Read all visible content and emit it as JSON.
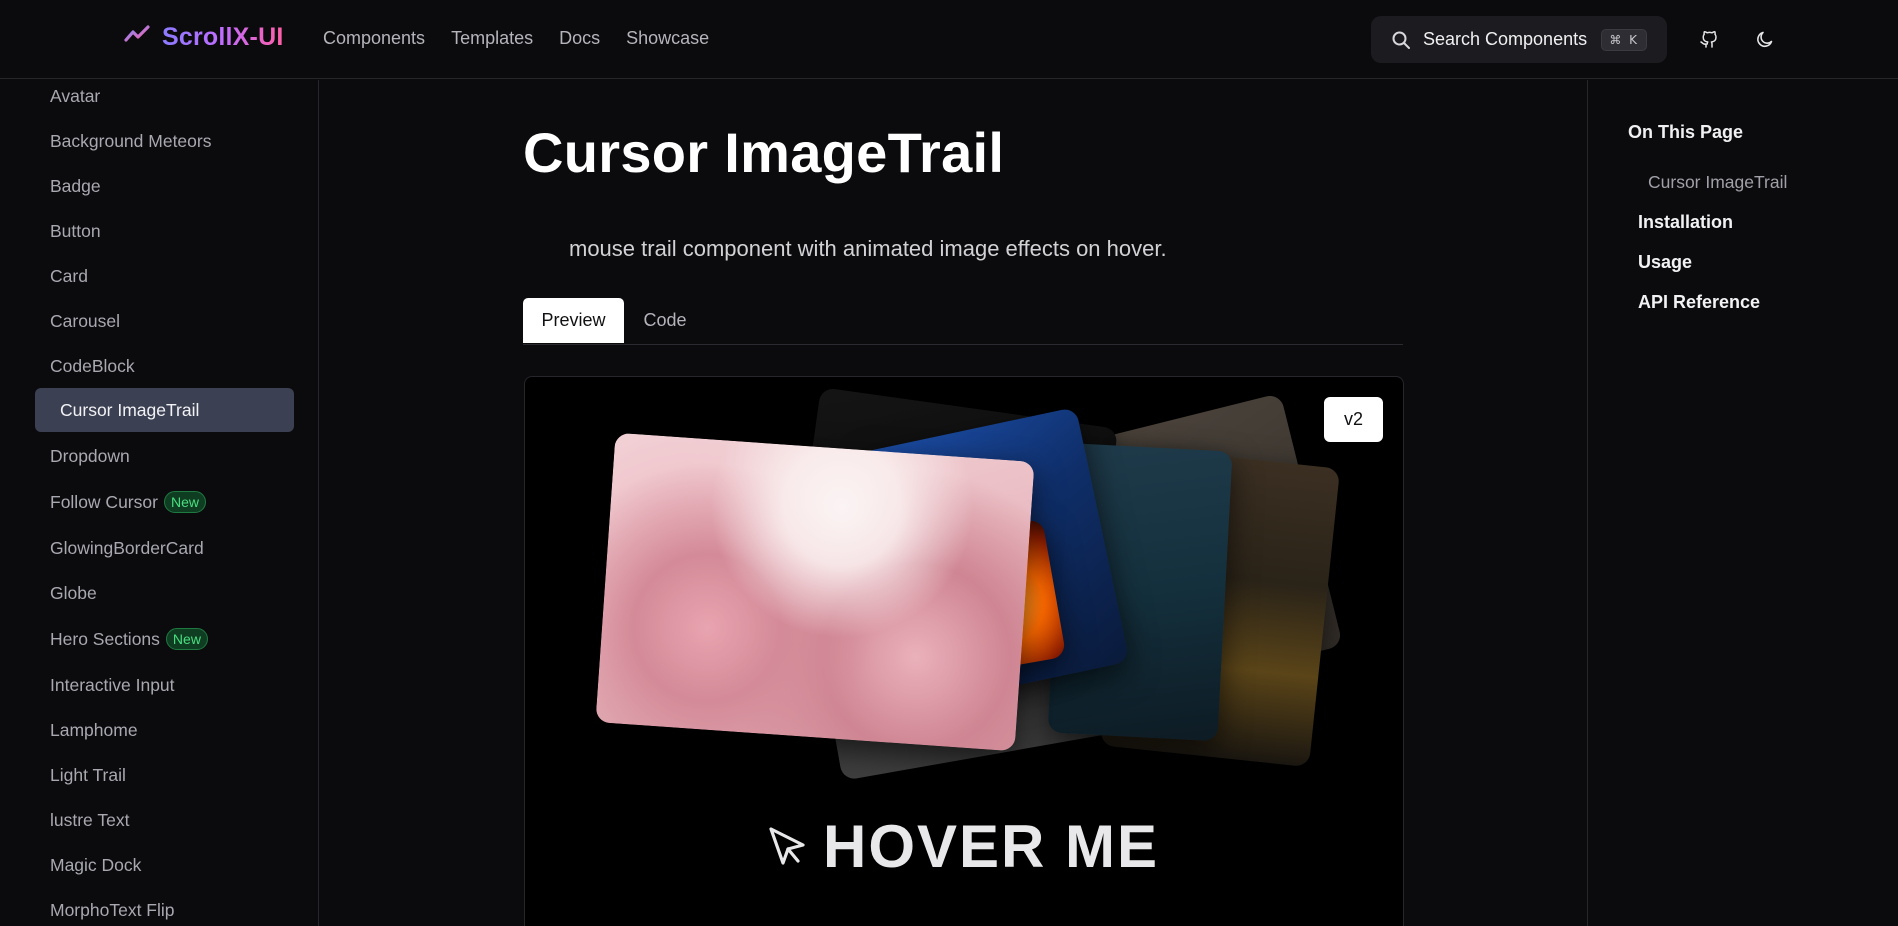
{
  "header": {
    "logo_text": "ScrollX-UI",
    "nav": [
      "Components",
      "Templates",
      "Docs",
      "Showcase"
    ],
    "search_label": "Search Components",
    "search_shortcut": "⌘ K",
    "icons": [
      "github-icon",
      "moon-icon"
    ]
  },
  "sidebar": {
    "items": [
      {
        "label": "Avatar"
      },
      {
        "label": "Background Meteors"
      },
      {
        "label": "Badge"
      },
      {
        "label": "Button"
      },
      {
        "label": "Card"
      },
      {
        "label": "Carousel"
      },
      {
        "label": "CodeBlock"
      },
      {
        "label": "Cursor ImageTrail",
        "active": true
      },
      {
        "label": "Dropdown"
      },
      {
        "label": "Follow Cursor",
        "badge": "New"
      },
      {
        "label": "GlowingBorderCard"
      },
      {
        "label": "Globe"
      },
      {
        "label": "Hero Sections",
        "badge": "New"
      },
      {
        "label": "Interactive Input"
      },
      {
        "label": "Lamphome"
      },
      {
        "label": "Light Trail"
      },
      {
        "label": "lustre Text"
      },
      {
        "label": "Magic Dock"
      },
      {
        "label": "MorphoText Flip"
      }
    ]
  },
  "main": {
    "title": "Cursor ImageTrail",
    "description": "mouse trail component with animated image effects on hover.",
    "tabs": [
      "Preview",
      "Code"
    ],
    "active_tab": "Preview",
    "preview": {
      "version_badge": "v2",
      "hover_text": "HOVER ME"
    }
  },
  "toc": {
    "title": "On This Page",
    "sub_item": "Cursor ImageTrail",
    "links": [
      "Installation",
      "Usage",
      "API Reference"
    ]
  },
  "colors": {
    "background": "#0b0b0d",
    "active_sidebar": "#3b4152",
    "brand_gradient_start": "#8b7bff",
    "brand_gradient_end": "#ff5fa8",
    "new_badge": "#4ade80"
  }
}
